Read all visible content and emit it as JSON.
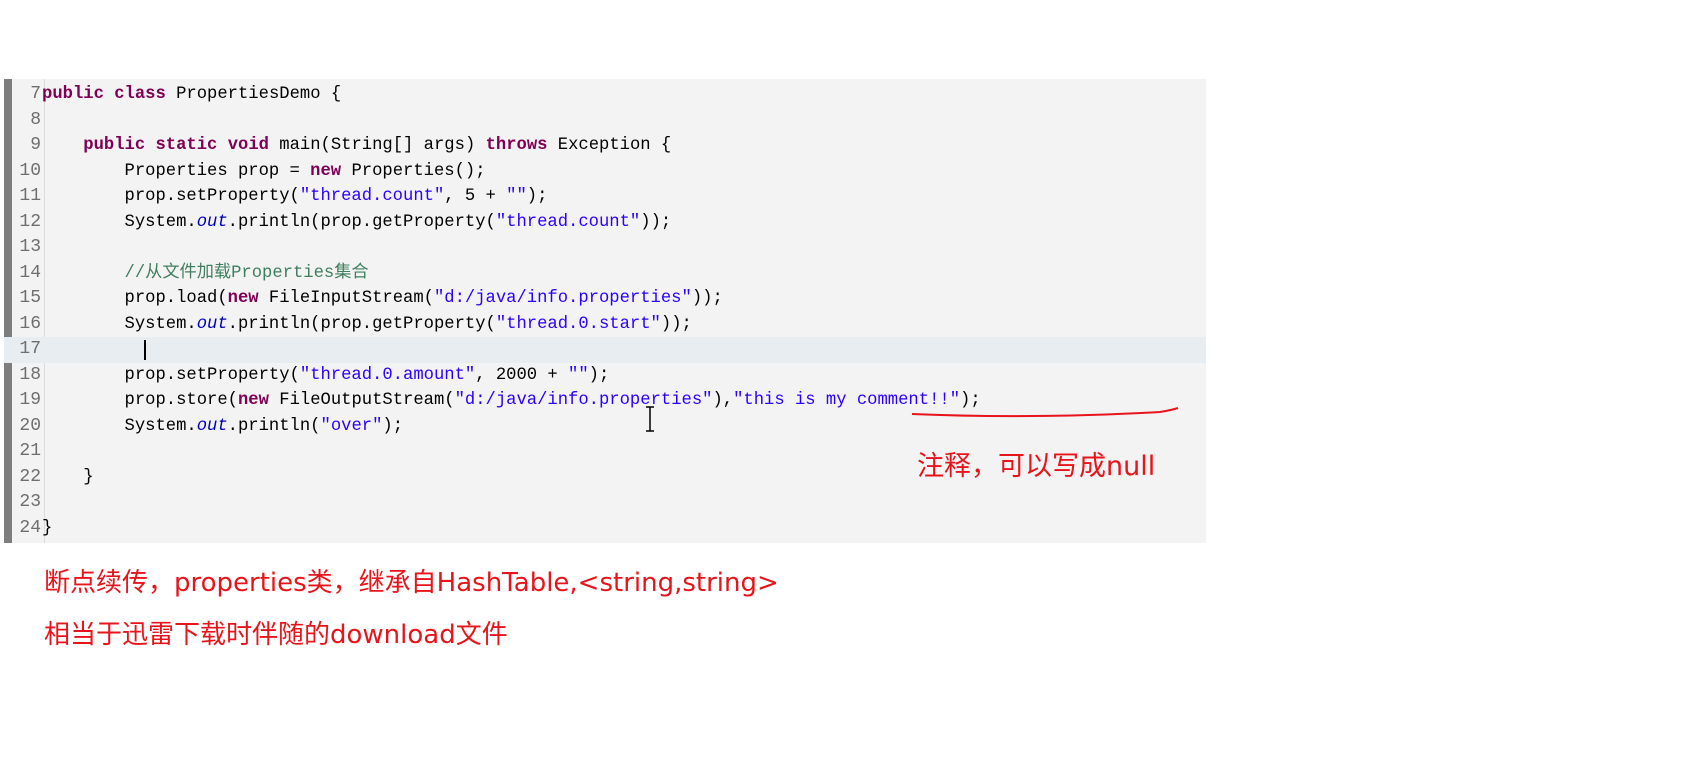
{
  "editor": {
    "lines": [
      {
        "num": "7",
        "tokens": [
          {
            "k": "kw",
            "t": "public"
          },
          {
            "k": "pl",
            "t": " "
          },
          {
            "k": "kw",
            "t": "class"
          },
          {
            "k": "pl",
            "t": " PropertiesDemo {"
          }
        ]
      },
      {
        "num": "8",
        "tokens": []
      },
      {
        "num": "9",
        "tokens": [
          {
            "k": "pl",
            "t": "    "
          },
          {
            "k": "kw",
            "t": "public"
          },
          {
            "k": "pl",
            "t": " "
          },
          {
            "k": "kw",
            "t": "static"
          },
          {
            "k": "pl",
            "t": " "
          },
          {
            "k": "kw",
            "t": "void"
          },
          {
            "k": "pl",
            "t": " main(String[] args) "
          },
          {
            "k": "kw",
            "t": "throws"
          },
          {
            "k": "pl",
            "t": " Exception {"
          }
        ]
      },
      {
        "num": "10",
        "tokens": [
          {
            "k": "pl",
            "t": "        Properties prop = "
          },
          {
            "k": "kw",
            "t": "new"
          },
          {
            "k": "pl",
            "t": " Properties();"
          }
        ]
      },
      {
        "num": "11",
        "tokens": [
          {
            "k": "pl",
            "t": "        prop.setProperty("
          },
          {
            "k": "str",
            "t": "\"thread.count\""
          },
          {
            "k": "pl",
            "t": ", 5 + "
          },
          {
            "k": "str",
            "t": "\"\""
          },
          {
            "k": "pl",
            "t": ");"
          }
        ]
      },
      {
        "num": "12",
        "tokens": [
          {
            "k": "pl",
            "t": "        System."
          },
          {
            "k": "fld",
            "t": "out"
          },
          {
            "k": "pl",
            "t": ".println(prop.getProperty("
          },
          {
            "k": "str",
            "t": "\"thread.count\""
          },
          {
            "k": "pl",
            "t": "));"
          }
        ]
      },
      {
        "num": "13",
        "tokens": []
      },
      {
        "num": "14",
        "tokens": [
          {
            "k": "pl",
            "t": "        "
          },
          {
            "k": "cmt",
            "t": "//从文件加载Properties集合"
          }
        ]
      },
      {
        "num": "15",
        "tokens": [
          {
            "k": "pl",
            "t": "        prop.load("
          },
          {
            "k": "kw",
            "t": "new"
          },
          {
            "k": "pl",
            "t": " FileInputStream("
          },
          {
            "k": "str",
            "t": "\"d:/java/info.properties\""
          },
          {
            "k": "pl",
            "t": "));"
          }
        ]
      },
      {
        "num": "16",
        "tokens": [
          {
            "k": "pl",
            "t": "        System."
          },
          {
            "k": "fld",
            "t": "out"
          },
          {
            "k": "pl",
            "t": ".println(prop.getProperty("
          },
          {
            "k": "str",
            "t": "\"thread.0.start\""
          },
          {
            "k": "pl",
            "t": "));"
          }
        ]
      },
      {
        "num": "17",
        "tokens": [],
        "current": true
      },
      {
        "num": "18",
        "tokens": [
          {
            "k": "pl",
            "t": "        prop.setProperty("
          },
          {
            "k": "str",
            "t": "\"thread.0.amount\""
          },
          {
            "k": "pl",
            "t": ", 2000 + "
          },
          {
            "k": "str",
            "t": "\"\""
          },
          {
            "k": "pl",
            "t": ");"
          }
        ]
      },
      {
        "num": "19",
        "tokens": [
          {
            "k": "pl",
            "t": "        prop.store("
          },
          {
            "k": "kw",
            "t": "new"
          },
          {
            "k": "pl",
            "t": " FileOutputStream("
          },
          {
            "k": "str",
            "t": "\"d:/java/info.properties\""
          },
          {
            "k": "pl",
            "t": "),"
          },
          {
            "k": "str",
            "t": "\"this is my comment!!\""
          },
          {
            "k": "pl",
            "t": ");"
          }
        ]
      },
      {
        "num": "20",
        "tokens": [
          {
            "k": "pl",
            "t": "        System."
          },
          {
            "k": "fld",
            "t": "out"
          },
          {
            "k": "pl",
            "t": ".println("
          },
          {
            "k": "str",
            "t": "\"over\""
          },
          {
            "k": "pl",
            "t": ");"
          }
        ]
      },
      {
        "num": "21",
        "tokens": []
      },
      {
        "num": "22",
        "tokens": [
          {
            "k": "pl",
            "t": "    }"
          }
        ]
      },
      {
        "num": "23",
        "tokens": []
      },
      {
        "num": "24",
        "tokens": [
          {
            "k": "pl",
            "t": "}"
          }
        ]
      }
    ]
  },
  "annotations": {
    "comment_note": "注释，可以写成null",
    "note_line1": "断点续传，properties类，继承自HashTable,<string,string>",
    "note_line2": "相当于迅雷下载时伴随的download文件"
  },
  "colors": {
    "keyword": "#7f0055",
    "string": "#2a00ff",
    "comment": "#3f7f5f",
    "field": "#0000c0",
    "annotation": "#e8141b"
  }
}
